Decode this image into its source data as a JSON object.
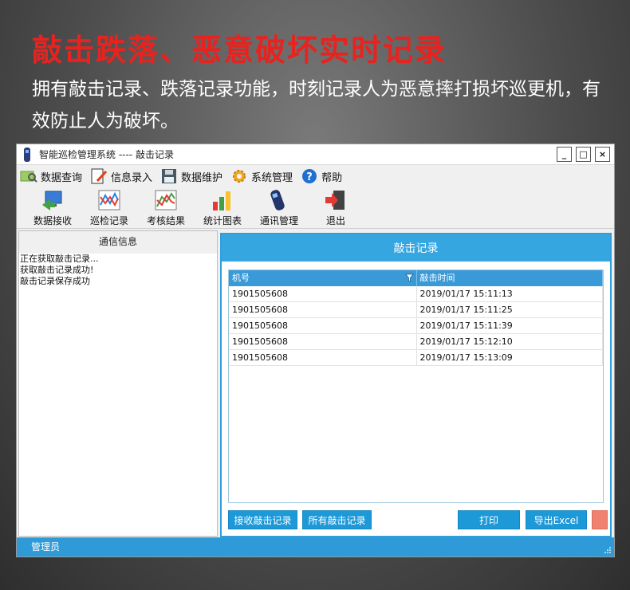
{
  "promo": {
    "headline": "敲击跌落、恶意破坏实时记录",
    "description": "拥有敲击记录、跌落记录功能，时刻记录人为恶意摔打损坏巡更机，有效防止人为破坏。"
  },
  "window": {
    "title": "智能巡检管理系统 ---- 敲击记录",
    "controls": {
      "minimize": "_",
      "maximize": "□",
      "close": "×"
    }
  },
  "menu": [
    {
      "label": "数据查询",
      "icon": "map-query-icon"
    },
    {
      "label": "信息录入",
      "icon": "edit-doc-icon"
    },
    {
      "label": "数据维护",
      "icon": "floppy-disk-icon"
    },
    {
      "label": "系统管理",
      "icon": "gear-icon"
    },
    {
      "label": "帮助",
      "icon": "help-icon"
    }
  ],
  "toolbar": [
    {
      "label": "数据接收",
      "icon": "data-receive-icon"
    },
    {
      "label": "巡检记录",
      "icon": "patrol-record-icon"
    },
    {
      "label": "考核结果",
      "icon": "assessment-icon"
    },
    {
      "label": "统计图表",
      "icon": "bar-chart-icon"
    },
    {
      "label": "通讯管理",
      "icon": "device-icon"
    },
    {
      "label": "退出",
      "icon": "exit-icon"
    }
  ],
  "left_panel": {
    "title": "通信信息",
    "logs": [
      "正在获取敲击记录...",
      "获取敲击记录成功!",
      "敲击记录保存成功"
    ]
  },
  "main_panel": {
    "title": "敲击记录",
    "columns": [
      "机号",
      "敲击时间"
    ],
    "rows": [
      [
        "1901505608",
        "2019/01/17 15:11:13"
      ],
      [
        "1901505608",
        "2019/01/17 15:11:25"
      ],
      [
        "1901505608",
        "2019/01/17 15:11:39"
      ],
      [
        "1901505608",
        "2019/01/17 15:12:10"
      ],
      [
        "1901505608",
        "2019/01/17 15:13:09"
      ]
    ],
    "buttons": {
      "receive": "接收敲击记录",
      "all": "所有敲击记录",
      "print": "打印",
      "export": "导出Excel"
    }
  },
  "status": {
    "user": "管理员"
  },
  "colors": {
    "accent": "#36a6e0",
    "headline": "#e8231f",
    "extra_button": "#f08070"
  }
}
